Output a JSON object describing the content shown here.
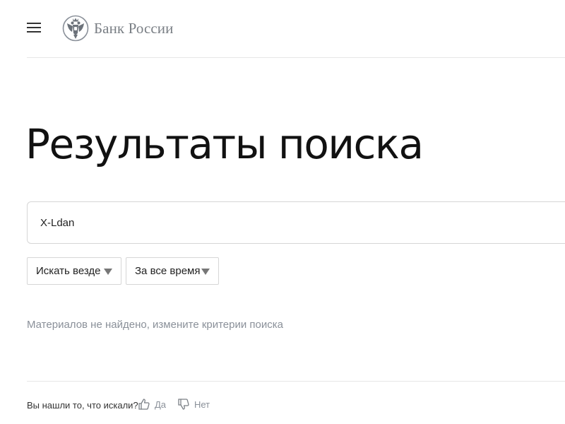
{
  "header": {
    "menu_icon": "hamburger-icon",
    "logo_icon": "double-headed-eagle-icon",
    "logo_text": "Банк России"
  },
  "main": {
    "title": "Результаты поиска",
    "search": {
      "value": "X-Ldan"
    },
    "filters": [
      {
        "selected": "Искать везде",
        "icon": "triangle-down-icon"
      },
      {
        "selected": "За все время",
        "icon": "triangle-down-icon"
      }
    ],
    "empty_message": "Материалов не найдено, измените критерии поиска"
  },
  "feedback": {
    "question": "Вы нашли то, что искали?",
    "yes_label": "Да",
    "yes_icon": "thumbs-up-icon",
    "no_label": "Нет",
    "no_icon": "thumbs-down-icon"
  },
  "colors": {
    "text_primary": "#111111",
    "text_muted": "#8a9099",
    "border": "#d6d6d6",
    "logo_gray": "#7a7f85"
  }
}
